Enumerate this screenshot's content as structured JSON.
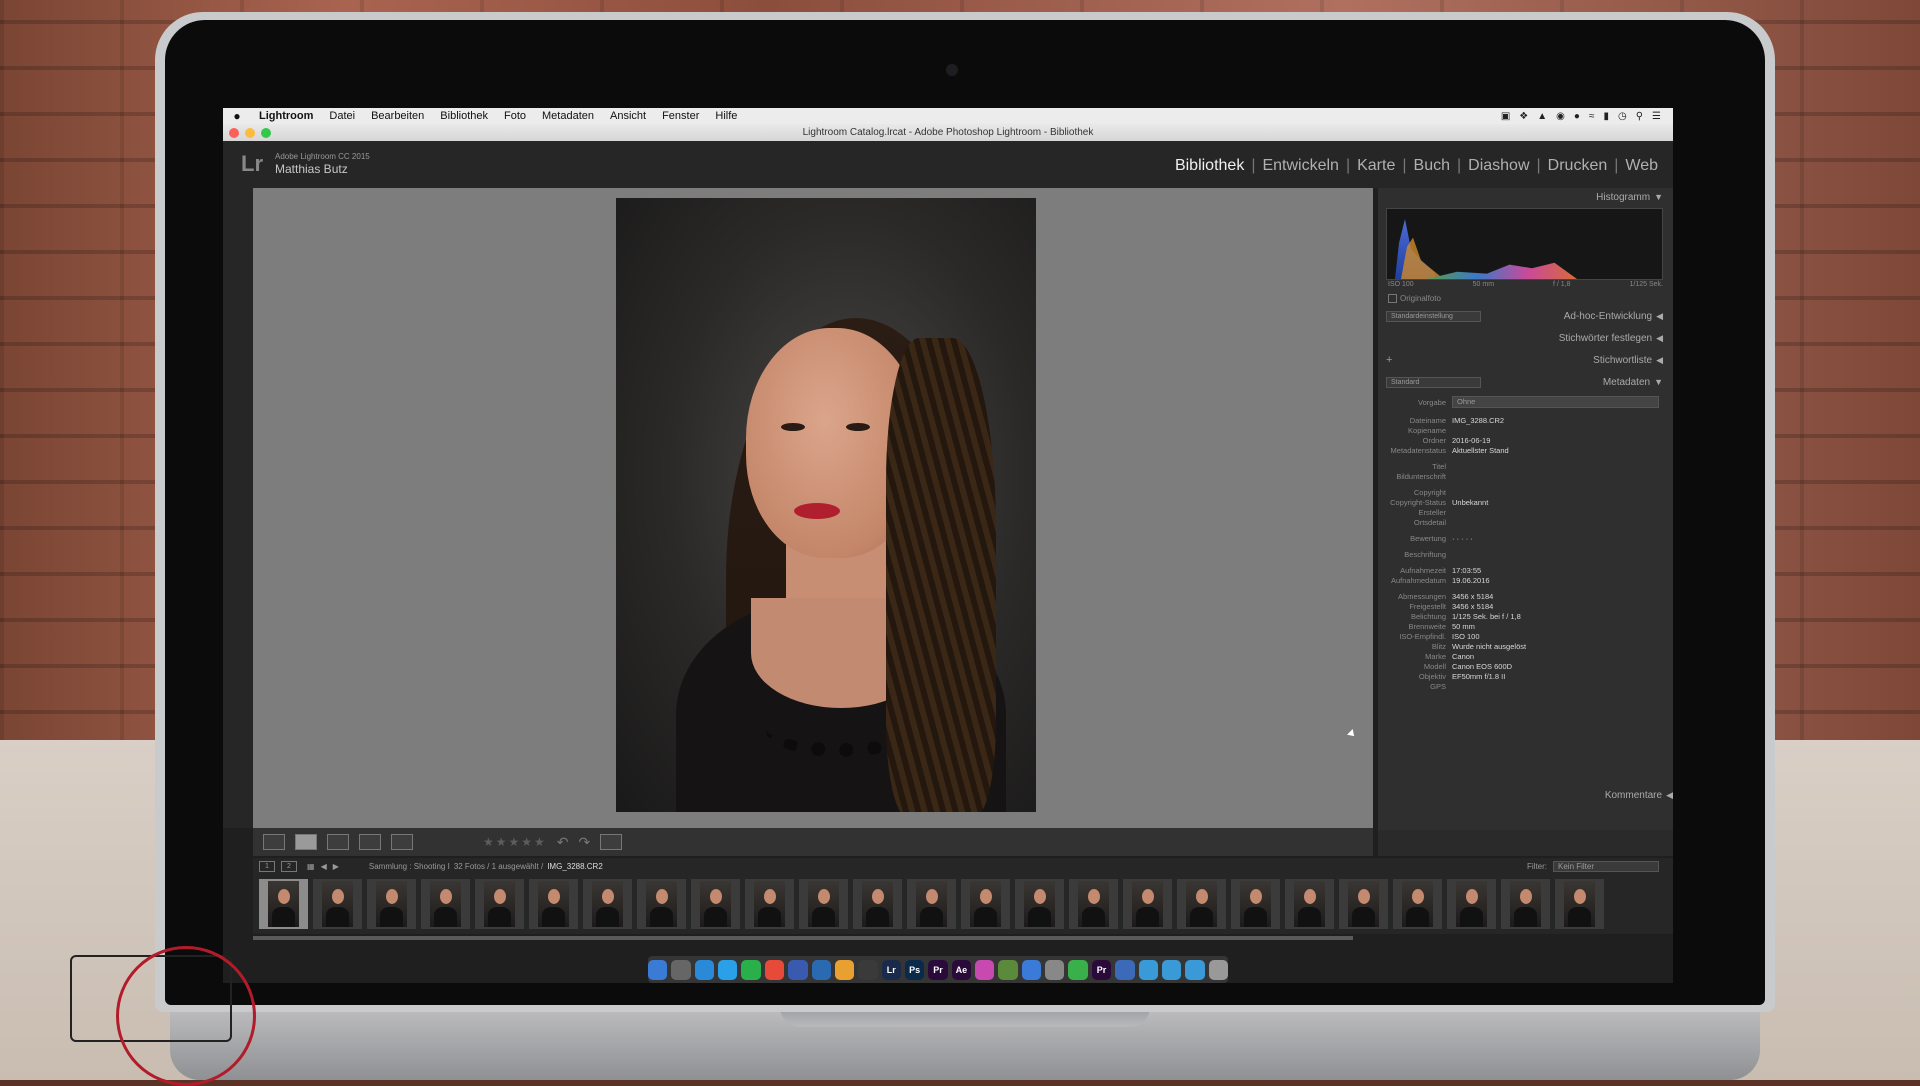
{
  "menubar": {
    "apple": "",
    "items": [
      "Lightroom",
      "Datei",
      "Bearbeiten",
      "Bibliothek",
      "Foto",
      "Metadaten",
      "Ansicht",
      "Fenster",
      "Hilfe"
    ]
  },
  "window": {
    "title": "Lightroom Catalog.lrcat - Adobe Photoshop Lightroom - Bibliothek"
  },
  "identity": {
    "logo": "Lr",
    "version": "Adobe Lightroom CC 2015",
    "user": "Matthias Butz"
  },
  "modules": [
    {
      "label": "Bibliothek",
      "active": true
    },
    {
      "label": "Entwickeln"
    },
    {
      "label": "Karte"
    },
    {
      "label": "Buch"
    },
    {
      "label": "Diashow"
    },
    {
      "label": "Drucken"
    },
    {
      "label": "Web"
    }
  ],
  "panels": {
    "histogram": "Histogramm",
    "hist_info": [
      "ISO 100",
      "50 mm",
      "f / 1,8",
      "1/125 Sek."
    ],
    "original_photo": "Originalfoto",
    "quick_develop_preset": "Standardeinstellung",
    "quick_develop": "Ad-hoc-Entwicklung",
    "keywording": "Stichwörter festlegen",
    "keyword_list": "Stichwortliste",
    "metadata_preset": "Standard",
    "metadata": "Metadaten",
    "comments": "Kommentare"
  },
  "metadata": {
    "preset_label": "Vorgabe",
    "preset_value": "Ohne",
    "rows": [
      {
        "k": "Dateiname",
        "v": "IMG_3288.CR2"
      },
      {
        "k": "Kopiename",
        "v": ""
      },
      {
        "k": "Ordner",
        "v": "2016-06-19"
      },
      {
        "k": "Metadatenstatus",
        "v": "Aktuellster Stand"
      },
      {
        "k": "Titel",
        "v": "",
        "gap": true
      },
      {
        "k": "Bildunterschrift",
        "v": ""
      },
      {
        "k": "Copyright",
        "v": "",
        "gap": true
      },
      {
        "k": "Copyright-Status",
        "v": "Unbekannt"
      },
      {
        "k": "Ersteller",
        "v": ""
      },
      {
        "k": "Ortsdetail",
        "v": ""
      },
      {
        "k": "Bewertung",
        "v": "· · · · ·",
        "gap": true
      },
      {
        "k": "Beschriftung",
        "v": "",
        "gap": true
      },
      {
        "k": "Aufnahmezeit",
        "v": "17:03:55",
        "gap": true
      },
      {
        "k": "Aufnahmedatum",
        "v": "19.06.2016"
      },
      {
        "k": "Abmessungen",
        "v": "3456 x 5184",
        "gap": true
      },
      {
        "k": "Freigestellt",
        "v": "3456 x 5184"
      },
      {
        "k": "Belichtung",
        "v": "1/125 Sek. bei f / 1,8"
      },
      {
        "k": "Brennweite",
        "v": "50 mm"
      },
      {
        "k": "ISO-Empfindl.",
        "v": "ISO 100"
      },
      {
        "k": "Blitz",
        "v": "Wurde nicht ausgelöst"
      },
      {
        "k": "Marke",
        "v": "Canon"
      },
      {
        "k": "Modell",
        "v": "Canon EOS 600D"
      },
      {
        "k": "Objektiv",
        "v": "EF50mm f/1.8 II"
      },
      {
        "k": "GPS",
        "v": ""
      }
    ]
  },
  "filmstrip": {
    "page1": "1",
    "page2": "2",
    "path": "Sammlung : Shooting I",
    "count": "32 Fotos / 1 ausgewählt /",
    "filename": "IMG_3288.CR2",
    "filter_label": "Filter:",
    "filter_value": "Kein Filter",
    "thumb_count": 25,
    "selected_index": 0
  },
  "toolbar": {
    "stars": "★★★★★"
  },
  "dock": [
    "",
    "",
    "",
    "",
    "",
    "",
    "",
    "",
    "",
    "",
    "Lr",
    "Ps",
    "Pr",
    "Ae",
    "",
    "",
    "",
    "",
    "",
    "Pr",
    "",
    "",
    "",
    "",
    ""
  ],
  "colors": {
    "accent_red": "#b21b2a",
    "lr_panel": "#2f2f2f",
    "canvas_gray": "#7d7d7d"
  }
}
